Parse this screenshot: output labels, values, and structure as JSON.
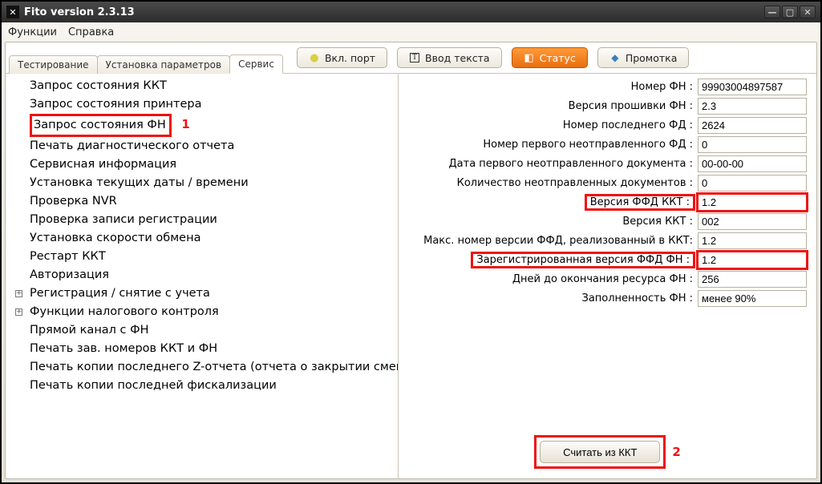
{
  "window": {
    "title": "Fito version 2.3.13"
  },
  "menu": {
    "functions": "Функции",
    "help": "Справка"
  },
  "tabs": {
    "testing": "Тестирование",
    "params": "Установка параметров",
    "service": "Сервис"
  },
  "toolbar": {
    "port": "Вкл. порт",
    "input_text": "Ввод текста",
    "status": "Статус",
    "feed": "Промотка"
  },
  "tree": [
    "Запрос состояния ККТ",
    "Запрос состояния принтера",
    "Запрос состояния ФН",
    "Печать диагностического отчета",
    "Сервисная информация",
    "Установка текущих даты / времени",
    "Проверка NVR",
    "Проверка записи регистрации",
    "Установка скорости обмена",
    "Рестарт ККТ",
    "Авторизация",
    "Регистрация / снятие с учета",
    "Функции налогового контроля",
    "Прямой канал с ФН",
    "Печать зав. номеров ККТ и ФН",
    "Печать копии последнего Z-отчета (отчета о закрытии смены)",
    "Печать копии последней фискализации"
  ],
  "annotations": {
    "one": "1",
    "two": "2"
  },
  "form": [
    {
      "label": "Номер ФН :",
      "value": "99903004897587"
    },
    {
      "label": "Версия прошивки ФН :",
      "value": "2.3"
    },
    {
      "label": "Номер последнего ФД :",
      "value": "2624"
    },
    {
      "label": "Номер первого неотправленного ФД :",
      "value": "0"
    },
    {
      "label": "Дата первого неотправленного документа :",
      "value": "00-00-00"
    },
    {
      "label": "Количество неотправленных документов :",
      "value": "0"
    },
    {
      "label": "Версия ФФД ККТ :",
      "value": "1.2",
      "hl": true
    },
    {
      "label": "Версия ККТ :",
      "value": "002"
    },
    {
      "label": "Макс. номер версии ФФД, реализованный в ККТ:",
      "value": "1.2"
    },
    {
      "label": "Зарегистрированная версия ФФД ФН :",
      "value": "1.2",
      "hl": true
    },
    {
      "label": "Дней до окончания ресурса ФН :",
      "value": "256"
    },
    {
      "label": "Заполненность ФН :",
      "value": "менее 90%"
    }
  ],
  "buttons": {
    "read_kkt": "Считать из ККТ"
  }
}
